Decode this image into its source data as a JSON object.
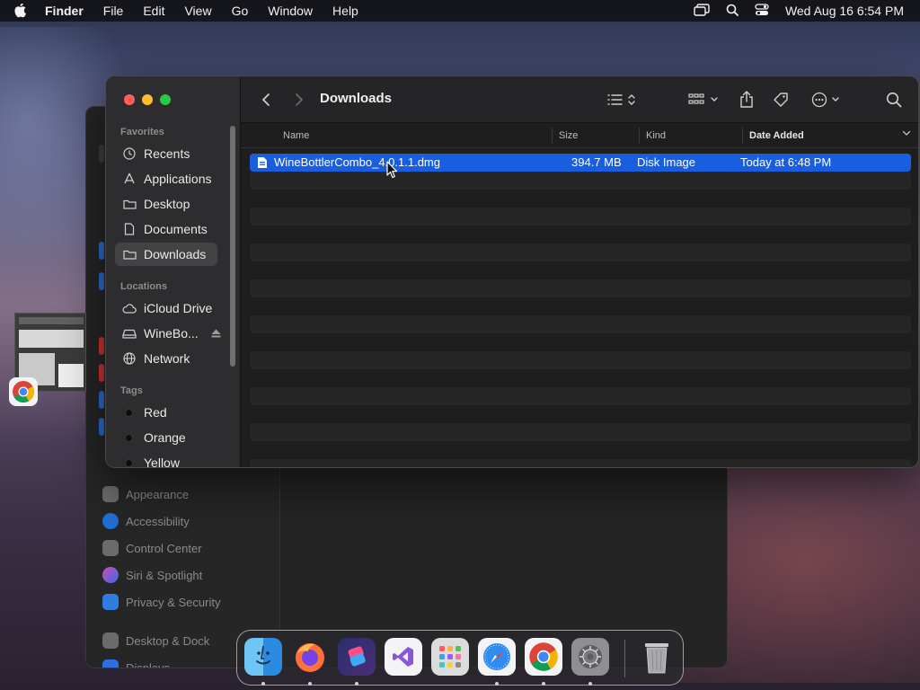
{
  "menubar": {
    "app": "Finder",
    "items": [
      "File",
      "Edit",
      "View",
      "Go",
      "Window",
      "Help"
    ],
    "clock": "Wed Aug 16  6:54 PM"
  },
  "background_settings": {
    "items": [
      {
        "label": "Appearance",
        "icon": "appearance-icon",
        "color": "#5e5e5e"
      },
      {
        "label": "Accessibility",
        "icon": "accessibility-icon",
        "color": "#1f6fd1"
      },
      {
        "label": "Control Center",
        "icon": "control-center-icon",
        "color": "#6b6b6b"
      },
      {
        "label": "Siri & Spotlight",
        "icon": "siri-icon",
        "color": "#b04bd6"
      },
      {
        "label": "Privacy & Security",
        "icon": "privacy-icon",
        "color": "#2f7de0"
      },
      {
        "label": "Desktop & Dock",
        "icon": "desktop-dock-icon",
        "color": "#5a5a5a"
      },
      {
        "label": "Displays",
        "icon": "displays-icon",
        "color": "#2d6ee0"
      }
    ]
  },
  "finder": {
    "title": "Downloads",
    "sidebar": {
      "favorites_header": "Favorites",
      "favorites": [
        {
          "label": "Recents",
          "icon": "clock-icon"
        },
        {
          "label": "Applications",
          "icon": "applications-icon"
        },
        {
          "label": "Desktop",
          "icon": "desktop-folder-icon"
        },
        {
          "label": "Documents",
          "icon": "document-icon"
        },
        {
          "label": "Downloads",
          "icon": "downloads-folder-icon",
          "selected": true
        }
      ],
      "locations_header": "Locations",
      "locations": [
        {
          "label": "iCloud Drive",
          "icon": "cloud-icon"
        },
        {
          "label": "WineBo...",
          "icon": "disk-icon",
          "eject": true
        },
        {
          "label": "Network",
          "icon": "globe-icon"
        }
      ],
      "tags_header": "Tags",
      "tags": [
        {
          "label": "Red"
        },
        {
          "label": "Orange"
        },
        {
          "label": "Yellow"
        }
      ]
    },
    "columns": {
      "name": "Name",
      "size": "Size",
      "kind": "Kind",
      "date_added": "Date Added"
    },
    "files": [
      {
        "name": "WineBottlerCombo_4.0.1.1.dmg",
        "size": "394.7 MB",
        "kind": "Disk Image",
        "date_added": "Today at 6:48 PM",
        "selected": true
      }
    ]
  },
  "dock": {
    "apps": [
      {
        "name": "Finder",
        "icon": "finder-icon",
        "running": true
      },
      {
        "name": "Firefox",
        "icon": "firefox-icon",
        "running": true
      },
      {
        "name": "Shortcuts",
        "icon": "shortcuts-icon",
        "running": true
      },
      {
        "name": "Visual Studio",
        "icon": "visual-studio-icon",
        "running": false
      },
      {
        "name": "Launchpad",
        "icon": "launchpad-icon",
        "running": false
      },
      {
        "name": "Safari",
        "icon": "safari-icon",
        "running": true
      },
      {
        "name": "Chrome",
        "icon": "chrome-icon",
        "running": true
      },
      {
        "name": "System Settings",
        "icon": "settings-gear-icon",
        "running": true
      },
      {
        "name": "Trash",
        "icon": "trash-icon",
        "running": false
      }
    ]
  }
}
